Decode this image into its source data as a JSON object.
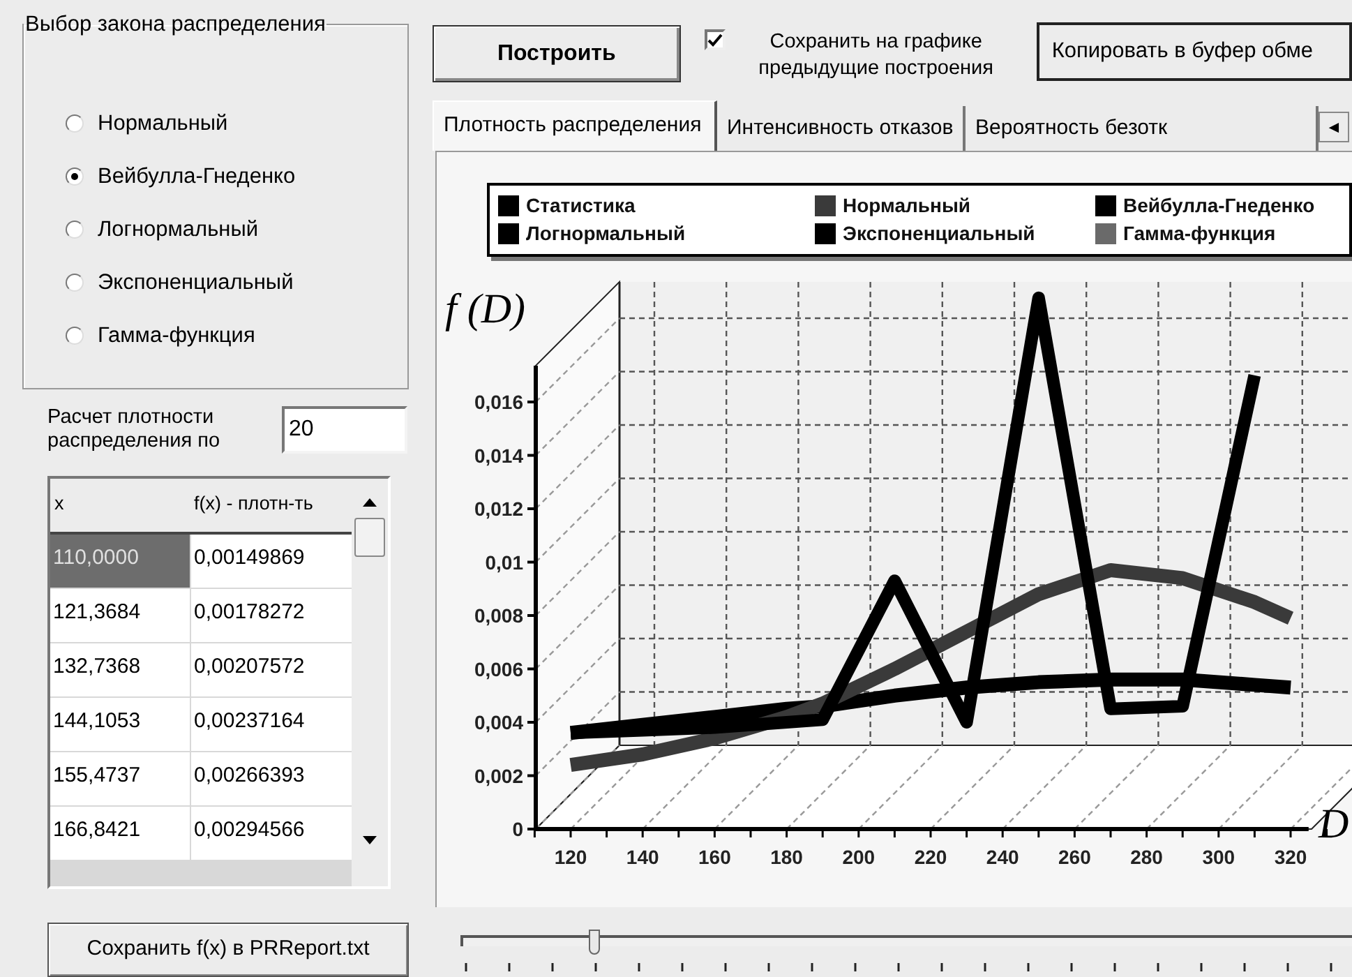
{
  "distribution_group": {
    "title": "Выбор закона распределения",
    "options": [
      {
        "label": "Нормальный",
        "selected": false
      },
      {
        "label": "Вейбулла-Гнеденко",
        "selected": true
      },
      {
        "label": "Логнормальный",
        "selected": false
      },
      {
        "label": "Экспоненциальный",
        "selected": false
      },
      {
        "label": "Гамма-функция",
        "selected": false
      }
    ]
  },
  "density_points": {
    "label": "Расчет плотности распределения по",
    "value": "20"
  },
  "table": {
    "columns": [
      "x",
      "f(x) - плотн-ть"
    ],
    "rows": [
      {
        "cells": [
          "110,0000",
          "0,00149869"
        ],
        "selected": true
      },
      {
        "cells": [
          "121,3684",
          "0,00178272"
        ],
        "selected": false
      },
      {
        "cells": [
          "132,7368",
          "0,00207572"
        ],
        "selected": false
      },
      {
        "cells": [
          "144,1053",
          "0,00237164"
        ],
        "selected": false
      },
      {
        "cells": [
          "155,4737",
          "0,00266393"
        ],
        "selected": false
      },
      {
        "cells": [
          "166,8421",
          "0,00294566"
        ],
        "selected": false
      }
    ]
  },
  "save_button": "Сохранить f(x) в PRReport.txt",
  "build_button": "Построить",
  "keep_previous": {
    "label": "Сохранить на графике предыдущие построения",
    "checked": true
  },
  "copy_button": "Копировать в буфер обме",
  "tabs": [
    {
      "label": "Плотность распределения",
      "selected": true
    },
    {
      "label": "Интенсивность отказов",
      "selected": false
    },
    {
      "label": "Вероятность безотк",
      "selected": false
    }
  ],
  "tab_scroll": "◄",
  "chart_data": {
    "type": "line",
    "legend": "top",
    "xlabel": "D",
    "ylabel": "f (D)",
    "xlim": [
      110,
      325
    ],
    "ylim": [
      0,
      0.0205
    ],
    "x": [
      120,
      140,
      160,
      180,
      190,
      210,
      230,
      250,
      270,
      290,
      310,
      320
    ],
    "xticks": [
      120,
      140,
      160,
      180,
      200,
      220,
      240,
      260,
      280,
      300,
      320
    ],
    "yticks": [
      {
        "value": 0,
        "label": "0"
      },
      {
        "value": 0.002,
        "label": "0,002"
      },
      {
        "value": 0.004,
        "label": "0,004"
      },
      {
        "value": 0.006,
        "label": "0,006"
      },
      {
        "value": 0.008,
        "label": "0,008"
      },
      {
        "value": 0.01,
        "label": "0,01"
      },
      {
        "value": 0.012,
        "label": "0,012"
      },
      {
        "value": 0.014,
        "label": "0,014"
      },
      {
        "value": 0.016,
        "label": "0,016"
      }
    ],
    "series": [
      {
        "name": "Статистика",
        "color": "#000000",
        "values": [
          0.0036,
          0.0037,
          0.0038,
          0.004,
          0.0041,
          0.0093,
          0.004,
          0.0199,
          0.0045,
          0.0046,
          0.017,
          null
        ]
      },
      {
        "name": "Нормальный",
        "color": "#3a3a3a",
        "values": [
          0.0024,
          0.0028,
          0.0034,
          0.0042,
          0.0047,
          0.006,
          0.0074,
          0.0088,
          0.0097,
          0.0094,
          0.0085,
          0.0079
        ]
      },
      {
        "name": "Вейбулла-Гнеденко",
        "color": "#000000",
        "values": [
          0.0036,
          0.0039,
          0.0042,
          0.0045,
          0.0046,
          0.005,
          0.0053,
          0.0055,
          0.0056,
          0.0056,
          0.0054,
          0.0053
        ]
      },
      {
        "name": "Логнормальный",
        "color": "#000000",
        "values": [
          null,
          null,
          null,
          null,
          null,
          null,
          null,
          null,
          null,
          null,
          null,
          null
        ]
      },
      {
        "name": "Экспоненциальный",
        "color": "#000000",
        "values": [
          null,
          null,
          null,
          null,
          null,
          null,
          null,
          null,
          null,
          null,
          null,
          null
        ]
      },
      {
        "name": "Гамма-функция",
        "color": "#6a6a6a",
        "values": [
          null,
          null,
          null,
          null,
          null,
          null,
          null,
          null,
          null,
          null,
          null,
          null
        ]
      }
    ]
  },
  "slider": {
    "level": 0.15
  }
}
